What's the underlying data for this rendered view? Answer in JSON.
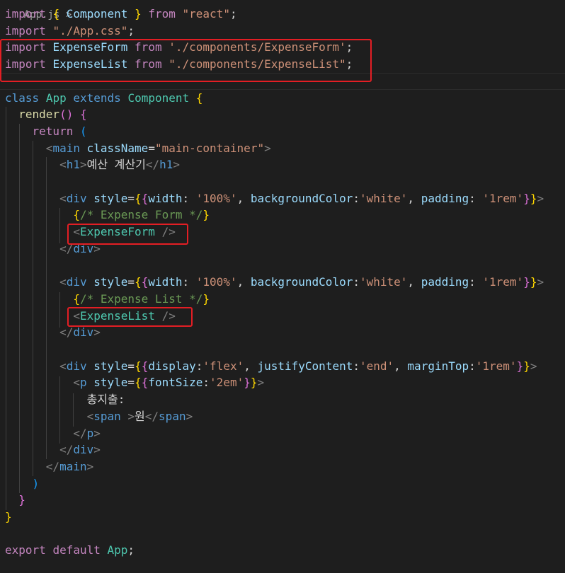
{
  "file_tab": "App.js > ...",
  "lines": [
    {
      "id": "l1",
      "tokens": [
        [
          "c-ctl",
          "import"
        ],
        [
          "c-pun",
          " "
        ],
        [
          "c-br1",
          "{"
        ],
        [
          "c-pun",
          " "
        ],
        [
          "c-var",
          "Component"
        ],
        [
          "c-pun",
          " "
        ],
        [
          "c-br1",
          "}"
        ],
        [
          "c-pun",
          " "
        ],
        [
          "c-ctl",
          "from"
        ],
        [
          "c-pun",
          " "
        ],
        [
          "c-str",
          "\"react\""
        ],
        [
          "c-pun",
          ";"
        ]
      ]
    },
    {
      "id": "l2",
      "tokens": [
        [
          "c-ctl",
          "import"
        ],
        [
          "c-pun",
          " "
        ],
        [
          "c-str",
          "\"./App.css\""
        ],
        [
          "c-pun",
          ";"
        ]
      ]
    },
    {
      "id": "l3",
      "tokens": [
        [
          "c-ctl",
          "import"
        ],
        [
          "c-pun",
          " "
        ],
        [
          "c-var",
          "ExpenseForm"
        ],
        [
          "c-pun",
          " "
        ],
        [
          "c-ctl",
          "from"
        ],
        [
          "c-pun",
          " "
        ],
        [
          "c-str",
          "'./components/ExpenseForm'"
        ],
        [
          "c-pun",
          ";"
        ]
      ]
    },
    {
      "id": "l4",
      "tokens": [
        [
          "c-ctl",
          "import"
        ],
        [
          "c-pun",
          " "
        ],
        [
          "c-var",
          "ExpenseList"
        ],
        [
          "c-pun",
          " "
        ],
        [
          "c-ctl",
          "from"
        ],
        [
          "c-pun",
          " "
        ],
        [
          "c-str",
          "\"./components/ExpenseList\""
        ],
        [
          "c-pun",
          ";"
        ]
      ]
    },
    {
      "id": "l5",
      "tokens": []
    },
    {
      "id": "l6",
      "tokens": [
        [
          "c-kw",
          "class"
        ],
        [
          "c-pun",
          " "
        ],
        [
          "c-cls",
          "App"
        ],
        [
          "c-pun",
          " "
        ],
        [
          "c-kw",
          "extends"
        ],
        [
          "c-pun",
          " "
        ],
        [
          "c-cls",
          "Component"
        ],
        [
          "c-pun",
          " "
        ],
        [
          "c-br1",
          "{"
        ]
      ]
    },
    {
      "id": "l7",
      "tokens": [
        [
          "c-pun",
          "  "
        ],
        [
          "c-fn",
          "render"
        ],
        [
          "c-br2",
          "()"
        ],
        [
          "c-pun",
          " "
        ],
        [
          "c-br2",
          "{"
        ]
      ]
    },
    {
      "id": "l8",
      "tokens": [
        [
          "c-pun",
          "    "
        ],
        [
          "c-ctl",
          "return"
        ],
        [
          "c-pun",
          " "
        ],
        [
          "c-br3",
          "("
        ]
      ]
    },
    {
      "id": "l9",
      "tokens": [
        [
          "c-pun",
          "      "
        ],
        [
          "c-tagp",
          "<"
        ],
        [
          "c-tag",
          "main"
        ],
        [
          "c-pun",
          " "
        ],
        [
          "c-attr",
          "className"
        ],
        [
          "c-pun",
          "="
        ],
        [
          "c-str",
          "\"main-container\""
        ],
        [
          "c-tagp",
          ">"
        ]
      ]
    },
    {
      "id": "l10",
      "tokens": [
        [
          "c-pun",
          "        "
        ],
        [
          "c-tagp",
          "<"
        ],
        [
          "c-tag",
          "h1"
        ],
        [
          "c-tagp",
          ">"
        ],
        [
          "c-txt",
          "예산 계산기"
        ],
        [
          "c-tagp",
          "</"
        ],
        [
          "c-tag",
          "h1"
        ],
        [
          "c-tagp",
          ">"
        ]
      ]
    },
    {
      "id": "l11",
      "tokens": []
    },
    {
      "id": "l12",
      "tokens": [
        [
          "c-pun",
          "        "
        ],
        [
          "c-tagp",
          "<"
        ],
        [
          "c-tag",
          "div"
        ],
        [
          "c-pun",
          " "
        ],
        [
          "c-attr",
          "style"
        ],
        [
          "c-pun",
          "="
        ],
        [
          "c-br1",
          "{"
        ],
        [
          "c-br2",
          "{"
        ],
        [
          "c-var",
          "width"
        ],
        [
          "c-pun",
          ": "
        ],
        [
          "c-str",
          "'100%'"
        ],
        [
          "c-pun",
          ", "
        ],
        [
          "c-var",
          "backgroundColor"
        ],
        [
          "c-pun",
          ":"
        ],
        [
          "c-str",
          "'white'"
        ],
        [
          "c-pun",
          ", "
        ],
        [
          "c-var",
          "padding"
        ],
        [
          "c-pun",
          ": "
        ],
        [
          "c-str",
          "'1rem'"
        ],
        [
          "c-br2",
          "}"
        ],
        [
          "c-br1",
          "}"
        ],
        [
          "c-tagp",
          ">"
        ]
      ]
    },
    {
      "id": "l13",
      "tokens": [
        [
          "c-pun",
          "          "
        ],
        [
          "c-br1",
          "{"
        ],
        [
          "c-cmt",
          "/* Expense Form */"
        ],
        [
          "c-br1",
          "}"
        ]
      ]
    },
    {
      "id": "l14",
      "tokens": [
        [
          "c-pun",
          "          "
        ],
        [
          "c-tagp",
          "<"
        ],
        [
          "c-cls",
          "ExpenseForm"
        ],
        [
          "c-pun",
          " "
        ],
        [
          "c-tagp",
          "/>"
        ]
      ]
    },
    {
      "id": "l15",
      "tokens": [
        [
          "c-pun",
          "        "
        ],
        [
          "c-tagp",
          "</"
        ],
        [
          "c-tag",
          "div"
        ],
        [
          "c-tagp",
          ">"
        ]
      ]
    },
    {
      "id": "l16",
      "tokens": []
    },
    {
      "id": "l17",
      "tokens": [
        [
          "c-pun",
          "        "
        ],
        [
          "c-tagp",
          "<"
        ],
        [
          "c-tag",
          "div"
        ],
        [
          "c-pun",
          " "
        ],
        [
          "c-attr",
          "style"
        ],
        [
          "c-pun",
          "="
        ],
        [
          "c-br1",
          "{"
        ],
        [
          "c-br2",
          "{"
        ],
        [
          "c-var",
          "width"
        ],
        [
          "c-pun",
          ": "
        ],
        [
          "c-str",
          "'100%'"
        ],
        [
          "c-pun",
          ", "
        ],
        [
          "c-var",
          "backgroundColor"
        ],
        [
          "c-pun",
          ":"
        ],
        [
          "c-str",
          "'white'"
        ],
        [
          "c-pun",
          ", "
        ],
        [
          "c-var",
          "padding"
        ],
        [
          "c-pun",
          ": "
        ],
        [
          "c-str",
          "'1rem'"
        ],
        [
          "c-br2",
          "}"
        ],
        [
          "c-br1",
          "}"
        ],
        [
          "c-tagp",
          ">"
        ]
      ]
    },
    {
      "id": "l18",
      "tokens": [
        [
          "c-pun",
          "          "
        ],
        [
          "c-br1",
          "{"
        ],
        [
          "c-cmt",
          "/* Expense List */"
        ],
        [
          "c-br1",
          "}"
        ]
      ]
    },
    {
      "id": "l19",
      "tokens": [
        [
          "c-pun",
          "          "
        ],
        [
          "c-tagp",
          "<"
        ],
        [
          "c-cls",
          "ExpenseList"
        ],
        [
          "c-pun",
          " "
        ],
        [
          "c-tagp",
          "/>"
        ]
      ]
    },
    {
      "id": "l20",
      "tokens": [
        [
          "c-pun",
          "        "
        ],
        [
          "c-tagp",
          "</"
        ],
        [
          "c-tag",
          "div"
        ],
        [
          "c-tagp",
          ">"
        ]
      ]
    },
    {
      "id": "l21",
      "tokens": []
    },
    {
      "id": "l22",
      "tokens": [
        [
          "c-pun",
          "        "
        ],
        [
          "c-tagp",
          "<"
        ],
        [
          "c-tag",
          "div"
        ],
        [
          "c-pun",
          " "
        ],
        [
          "c-attr",
          "style"
        ],
        [
          "c-pun",
          "="
        ],
        [
          "c-br1",
          "{"
        ],
        [
          "c-br2",
          "{"
        ],
        [
          "c-var",
          "display"
        ],
        [
          "c-pun",
          ":"
        ],
        [
          "c-str",
          "'flex'"
        ],
        [
          "c-pun",
          ", "
        ],
        [
          "c-var",
          "justifyContent"
        ],
        [
          "c-pun",
          ":"
        ],
        [
          "c-str",
          "'end'"
        ],
        [
          "c-pun",
          ", "
        ],
        [
          "c-var",
          "marginTop"
        ],
        [
          "c-pun",
          ":"
        ],
        [
          "c-str",
          "'1rem'"
        ],
        [
          "c-br2",
          "}"
        ],
        [
          "c-br1",
          "}"
        ],
        [
          "c-tagp",
          ">"
        ]
      ]
    },
    {
      "id": "l23",
      "tokens": [
        [
          "c-pun",
          "          "
        ],
        [
          "c-tagp",
          "<"
        ],
        [
          "c-tag",
          "p"
        ],
        [
          "c-pun",
          " "
        ],
        [
          "c-attr",
          "style"
        ],
        [
          "c-pun",
          "="
        ],
        [
          "c-br1",
          "{"
        ],
        [
          "c-br2",
          "{"
        ],
        [
          "c-var",
          "fontSize"
        ],
        [
          "c-pun",
          ":"
        ],
        [
          "c-str",
          "'2em'"
        ],
        [
          "c-br2",
          "}"
        ],
        [
          "c-br1",
          "}"
        ],
        [
          "c-tagp",
          ">"
        ]
      ]
    },
    {
      "id": "l24",
      "tokens": [
        [
          "c-pun",
          "            "
        ],
        [
          "c-txt",
          "총지출:"
        ]
      ]
    },
    {
      "id": "l25",
      "tokens": [
        [
          "c-pun",
          "            "
        ],
        [
          "c-tagp",
          "<"
        ],
        [
          "c-tag",
          "span"
        ],
        [
          "c-pun",
          " "
        ],
        [
          "c-tagp",
          ">"
        ],
        [
          "c-txt",
          "원"
        ],
        [
          "c-tagp",
          "</"
        ],
        [
          "c-tag",
          "span"
        ],
        [
          "c-tagp",
          ">"
        ]
      ]
    },
    {
      "id": "l26",
      "tokens": [
        [
          "c-pun",
          "          "
        ],
        [
          "c-tagp",
          "</"
        ],
        [
          "c-tag",
          "p"
        ],
        [
          "c-tagp",
          ">"
        ]
      ]
    },
    {
      "id": "l27",
      "tokens": [
        [
          "c-pun",
          "        "
        ],
        [
          "c-tagp",
          "</"
        ],
        [
          "c-tag",
          "div"
        ],
        [
          "c-tagp",
          ">"
        ]
      ]
    },
    {
      "id": "l28",
      "tokens": [
        [
          "c-pun",
          "      "
        ],
        [
          "c-tagp",
          "</"
        ],
        [
          "c-tag",
          "main"
        ],
        [
          "c-tagp",
          ">"
        ]
      ]
    },
    {
      "id": "l29",
      "tokens": [
        [
          "c-pun",
          "    "
        ],
        [
          "c-br3",
          ")"
        ]
      ]
    },
    {
      "id": "l30",
      "tokens": [
        [
          "c-pun",
          "  "
        ],
        [
          "c-br2",
          "}"
        ]
      ]
    },
    {
      "id": "l31",
      "tokens": [
        [
          "c-br1",
          "}"
        ]
      ]
    },
    {
      "id": "l32",
      "tokens": []
    },
    {
      "id": "l33",
      "tokens": [
        [
          "c-ctl",
          "export"
        ],
        [
          "c-pun",
          " "
        ],
        [
          "c-ctl",
          "default"
        ],
        [
          "c-pun",
          " "
        ],
        [
          "c-cls",
          "App"
        ],
        [
          "c-pun",
          ";"
        ]
      ]
    }
  ],
  "highlight_color": "#e31e24"
}
